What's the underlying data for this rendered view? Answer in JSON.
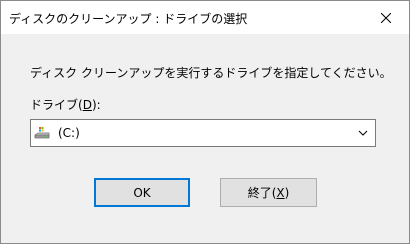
{
  "window": {
    "title": "ディスクのクリーンアップ : ドライブの選択"
  },
  "dialog": {
    "instruction": "ディスク クリーンアップを実行するドライブを指定してください。",
    "drive_label_prefix": "ドライブ(",
    "drive_label_accel": "D",
    "drive_label_suffix": "):",
    "selected_drive": "(C:)",
    "drive_icon": "hard-drive-icon"
  },
  "buttons": {
    "ok_label": "OK",
    "exit_label_prefix": "終了(",
    "exit_label_accel": "X",
    "exit_label_suffix": ")"
  },
  "colors": {
    "default_button_border": "#0078d7",
    "dialog_background": "#f0f0f0",
    "titlebar_background": "#ffffff"
  }
}
